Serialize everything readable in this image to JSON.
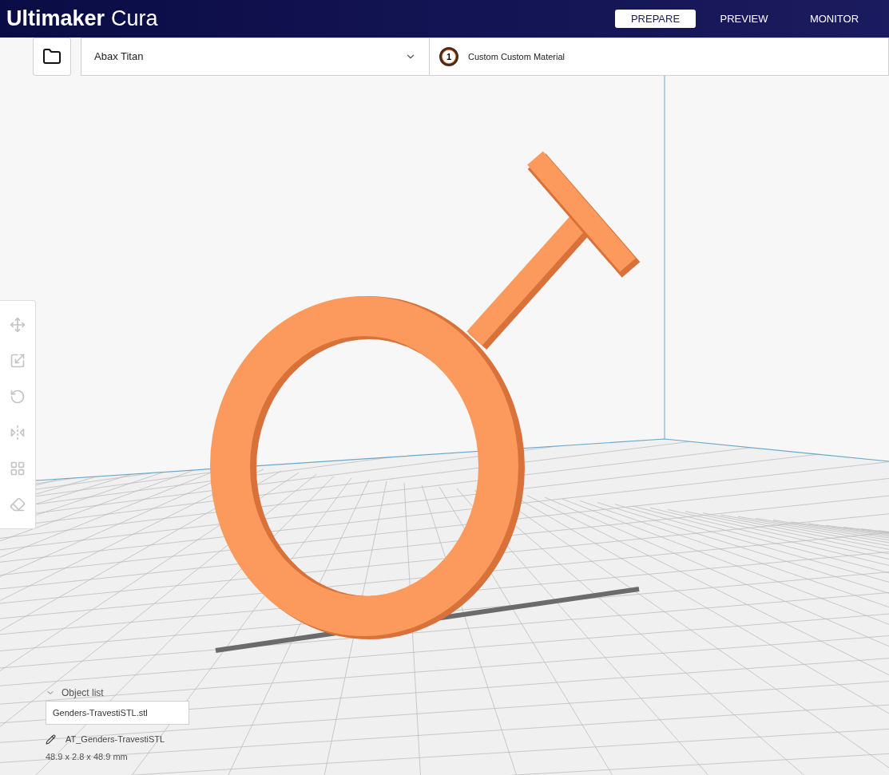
{
  "app_title": {
    "brand": "Ultimaker",
    "product": "Cura"
  },
  "stages": [
    {
      "label": "PREPARE",
      "selected": true
    },
    {
      "label": "PREVIEW",
      "selected": false
    },
    {
      "label": "MONITOR",
      "selected": false
    }
  ],
  "printer_selector": {
    "value": "Abax Titan"
  },
  "material_selector": {
    "extruder": "1",
    "material": "Custom Custom Material"
  },
  "tools": [
    {
      "kind": "move"
    },
    {
      "kind": "scale"
    },
    {
      "kind": "rotate"
    },
    {
      "kind": "mirror"
    },
    {
      "kind": "per-model"
    },
    {
      "kind": "support-blocker"
    }
  ],
  "object_list": {
    "title": "Object list",
    "expanded": true,
    "file_field": "Genders-TravestiSTL.stl",
    "object_name": "AT_Genders-TravestiSTL",
    "dimensions": "48.9 x 2.8 x 48.9 mm"
  }
}
